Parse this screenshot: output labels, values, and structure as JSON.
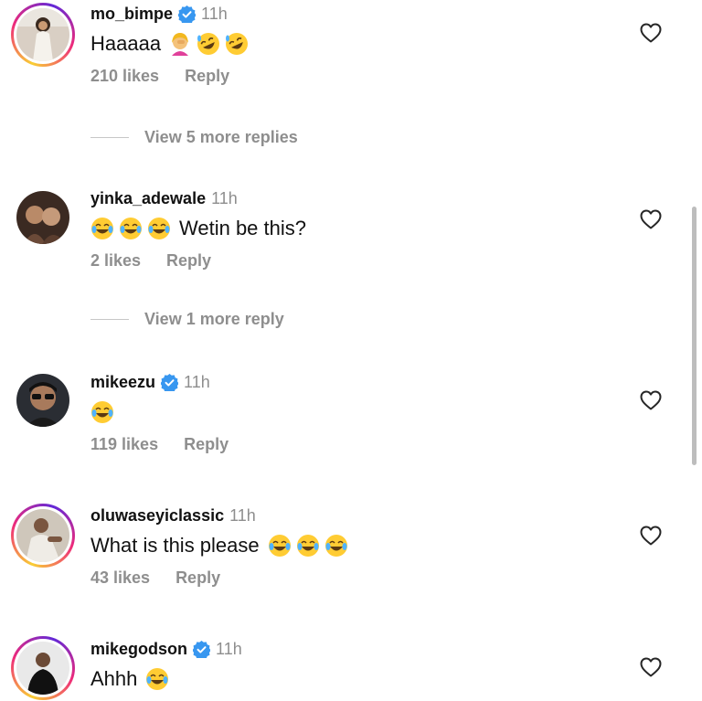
{
  "comments": [
    {
      "username": "mo_bimpe",
      "verified": true,
      "time": "11h",
      "text": "Haaaaa",
      "likes": "210 likes",
      "reply": "Reply",
      "emojis": [
        "woman-facepalming-icon",
        "rolling-on-floor-laughing-icon",
        "rolling-on-floor-laughing-icon"
      ],
      "view_more": "View 5 more replies"
    },
    {
      "username": "yinka_adewale",
      "verified": false,
      "time": "11h",
      "text": "Wetin be this?",
      "likes": "2 likes",
      "reply": "Reply",
      "emojis_before": [
        "face-with-tears-of-joy-icon",
        "face-with-tears-of-joy-icon",
        "face-with-tears-of-joy-icon"
      ],
      "view_more": "View 1 more reply"
    },
    {
      "username": "mikeezu",
      "verified": true,
      "time": "11h",
      "text": "",
      "likes": "119 likes",
      "reply": "Reply",
      "emojis": [
        "face-with-tears-of-joy-icon"
      ]
    },
    {
      "username": "oluwaseyiclassic",
      "verified": false,
      "time": "11h",
      "text": "What is this please",
      "likes": "43 likes",
      "reply": "Reply",
      "emojis": [
        "face-with-tears-of-joy-icon",
        "face-with-tears-of-joy-icon",
        "face-with-tears-of-joy-icon"
      ]
    },
    {
      "username": "mikegodson",
      "verified": true,
      "time": "11h",
      "text": "Ahhh",
      "emojis": [
        "face-with-tears-of-joy-icon"
      ]
    }
  ],
  "colors": {
    "verified": "#3897f0",
    "muted": "#8e8e8e",
    "emoji": "#ffcc33"
  }
}
